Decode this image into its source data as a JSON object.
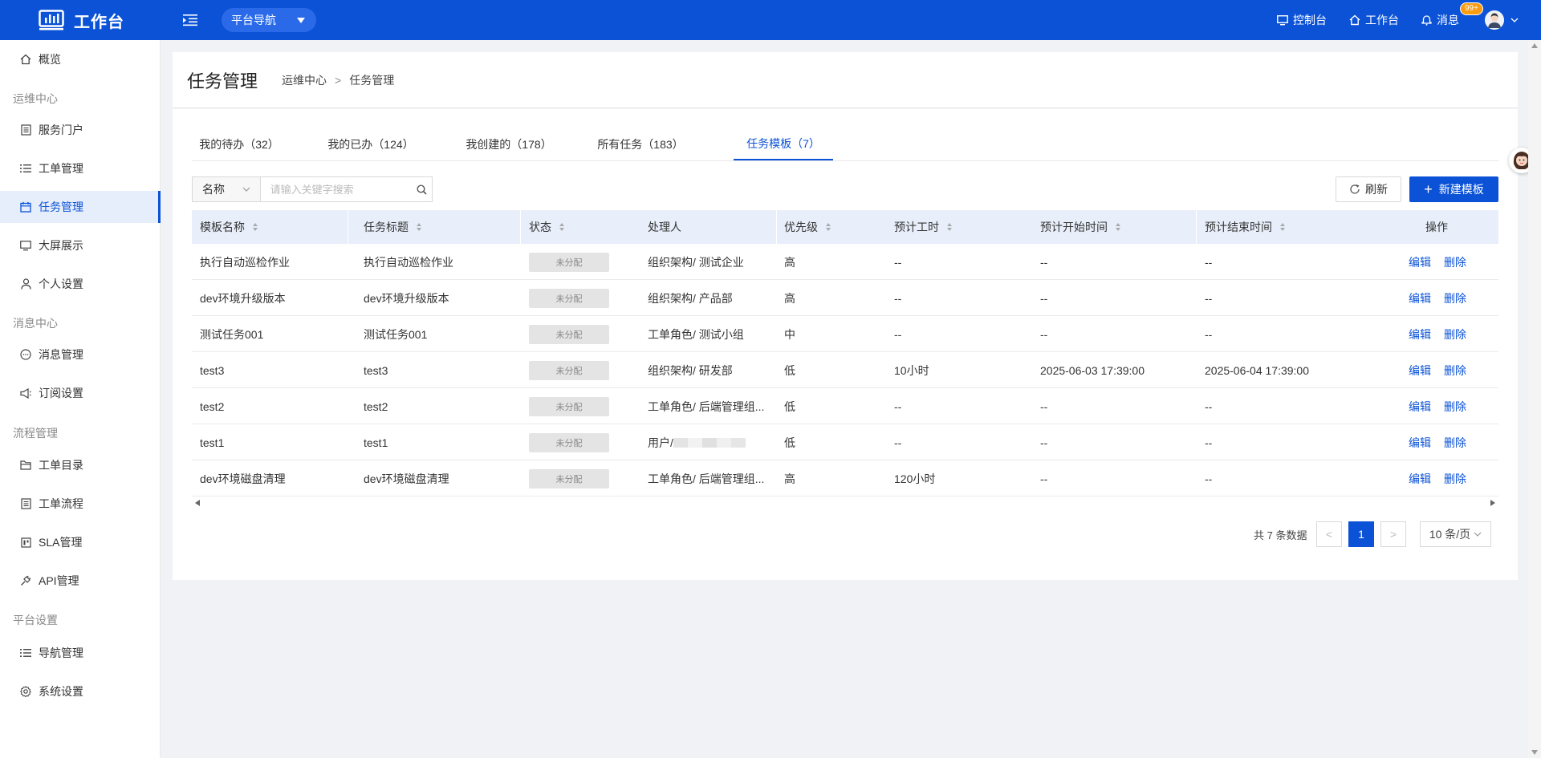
{
  "topbar": {
    "brand": "工作台",
    "platform_nav": "平台导航",
    "console": "控制台",
    "workbench": "工作台",
    "messages": "消息",
    "badge": "99+",
    "bg_color": "#0b52d6"
  },
  "sidebar": {
    "overview": "概览",
    "groups": {
      "ops": "运维中心",
      "msg": "消息中心",
      "flow": "流程管理",
      "platform": "平台设置"
    },
    "items": {
      "service_portal": "服务门户",
      "ticket_mgmt": "工单管理",
      "task_mgmt": "任务管理",
      "big_screen": "大屏展示",
      "personal": "个人设置",
      "msg_mgmt": "消息管理",
      "subscription": "订阅设置",
      "ticket_catalog": "工单目录",
      "ticket_flow": "工单流程",
      "sla": "SLA管理",
      "api": "API管理",
      "nav_mgmt": "导航管理",
      "sys_settings": "系统设置"
    }
  },
  "page": {
    "title": "任务管理",
    "breadcrumb_parent": "运维中心",
    "breadcrumb_sep": ">",
    "breadcrumb_current": "任务管理"
  },
  "tabs": [
    {
      "label": "我的待办（32）"
    },
    {
      "label": "我的已办（124）"
    },
    {
      "label": "我创建的（178）"
    },
    {
      "label": "所有任务（183）"
    },
    {
      "label": "任务模板（7）"
    }
  ],
  "filter": {
    "field": "名称",
    "placeholder": "请输入关键字搜索"
  },
  "actions": {
    "refresh": "刷新",
    "new_template": "新建模板"
  },
  "table": {
    "headers": {
      "name": "模板名称",
      "title": "任务标题",
      "status": "状态",
      "handler": "处理人",
      "priority": "优先级",
      "est_hours": "预计工时",
      "est_start": "预计开始时间",
      "est_end": "预计结束时间",
      "ops": "操作"
    },
    "edit": "编辑",
    "delete": "删除",
    "rows": [
      {
        "name": "执行自动巡检作业",
        "title": "执行自动巡检作业",
        "status": "未分配",
        "handler": "组织架构/ 测试企业",
        "priority": "高",
        "est_hours": "--",
        "est_start": "--",
        "est_end": "--"
      },
      {
        "name": "dev环境升级版本",
        "title": "dev环境升级版本",
        "status": "未分配",
        "handler": "组织架构/ 产品部",
        "priority": "高",
        "est_hours": "--",
        "est_start": "--",
        "est_end": "--"
      },
      {
        "name": "测试任务001",
        "title": "测试任务001",
        "status": "未分配",
        "handler": "工单角色/ 测试小组",
        "priority": "中",
        "est_hours": "--",
        "est_start": "--",
        "est_end": "--"
      },
      {
        "name": "test3",
        "title": "test3",
        "status": "未分配",
        "handler": "组织架构/ 研发部",
        "priority": "低",
        "est_hours": "10小时",
        "est_start": "2025-06-03 17:39:00",
        "est_end": "2025-06-04 17:39:00"
      },
      {
        "name": "test2",
        "title": "test2",
        "status": "未分配",
        "handler": "工单角色/ 后端管理组...",
        "priority": "低",
        "est_hours": "--",
        "est_start": "--",
        "est_end": "--"
      },
      {
        "name": "test1",
        "title": "test1",
        "status": "未分配",
        "handler": "用户/",
        "priority": "低",
        "est_hours": "--",
        "est_start": "--",
        "est_end": "--"
      },
      {
        "name": "dev环境磁盘清理",
        "title": "dev环境磁盘清理",
        "status": "未分配",
        "handler": "工单角色/ 后端管理组...",
        "priority": "高",
        "est_hours": "120小时",
        "est_start": "--",
        "est_end": "--"
      }
    ]
  },
  "pagination": {
    "total": "共 7 条数据",
    "prev": "<",
    "current": "1",
    "next": ">",
    "page_size": "10 条/页"
  }
}
